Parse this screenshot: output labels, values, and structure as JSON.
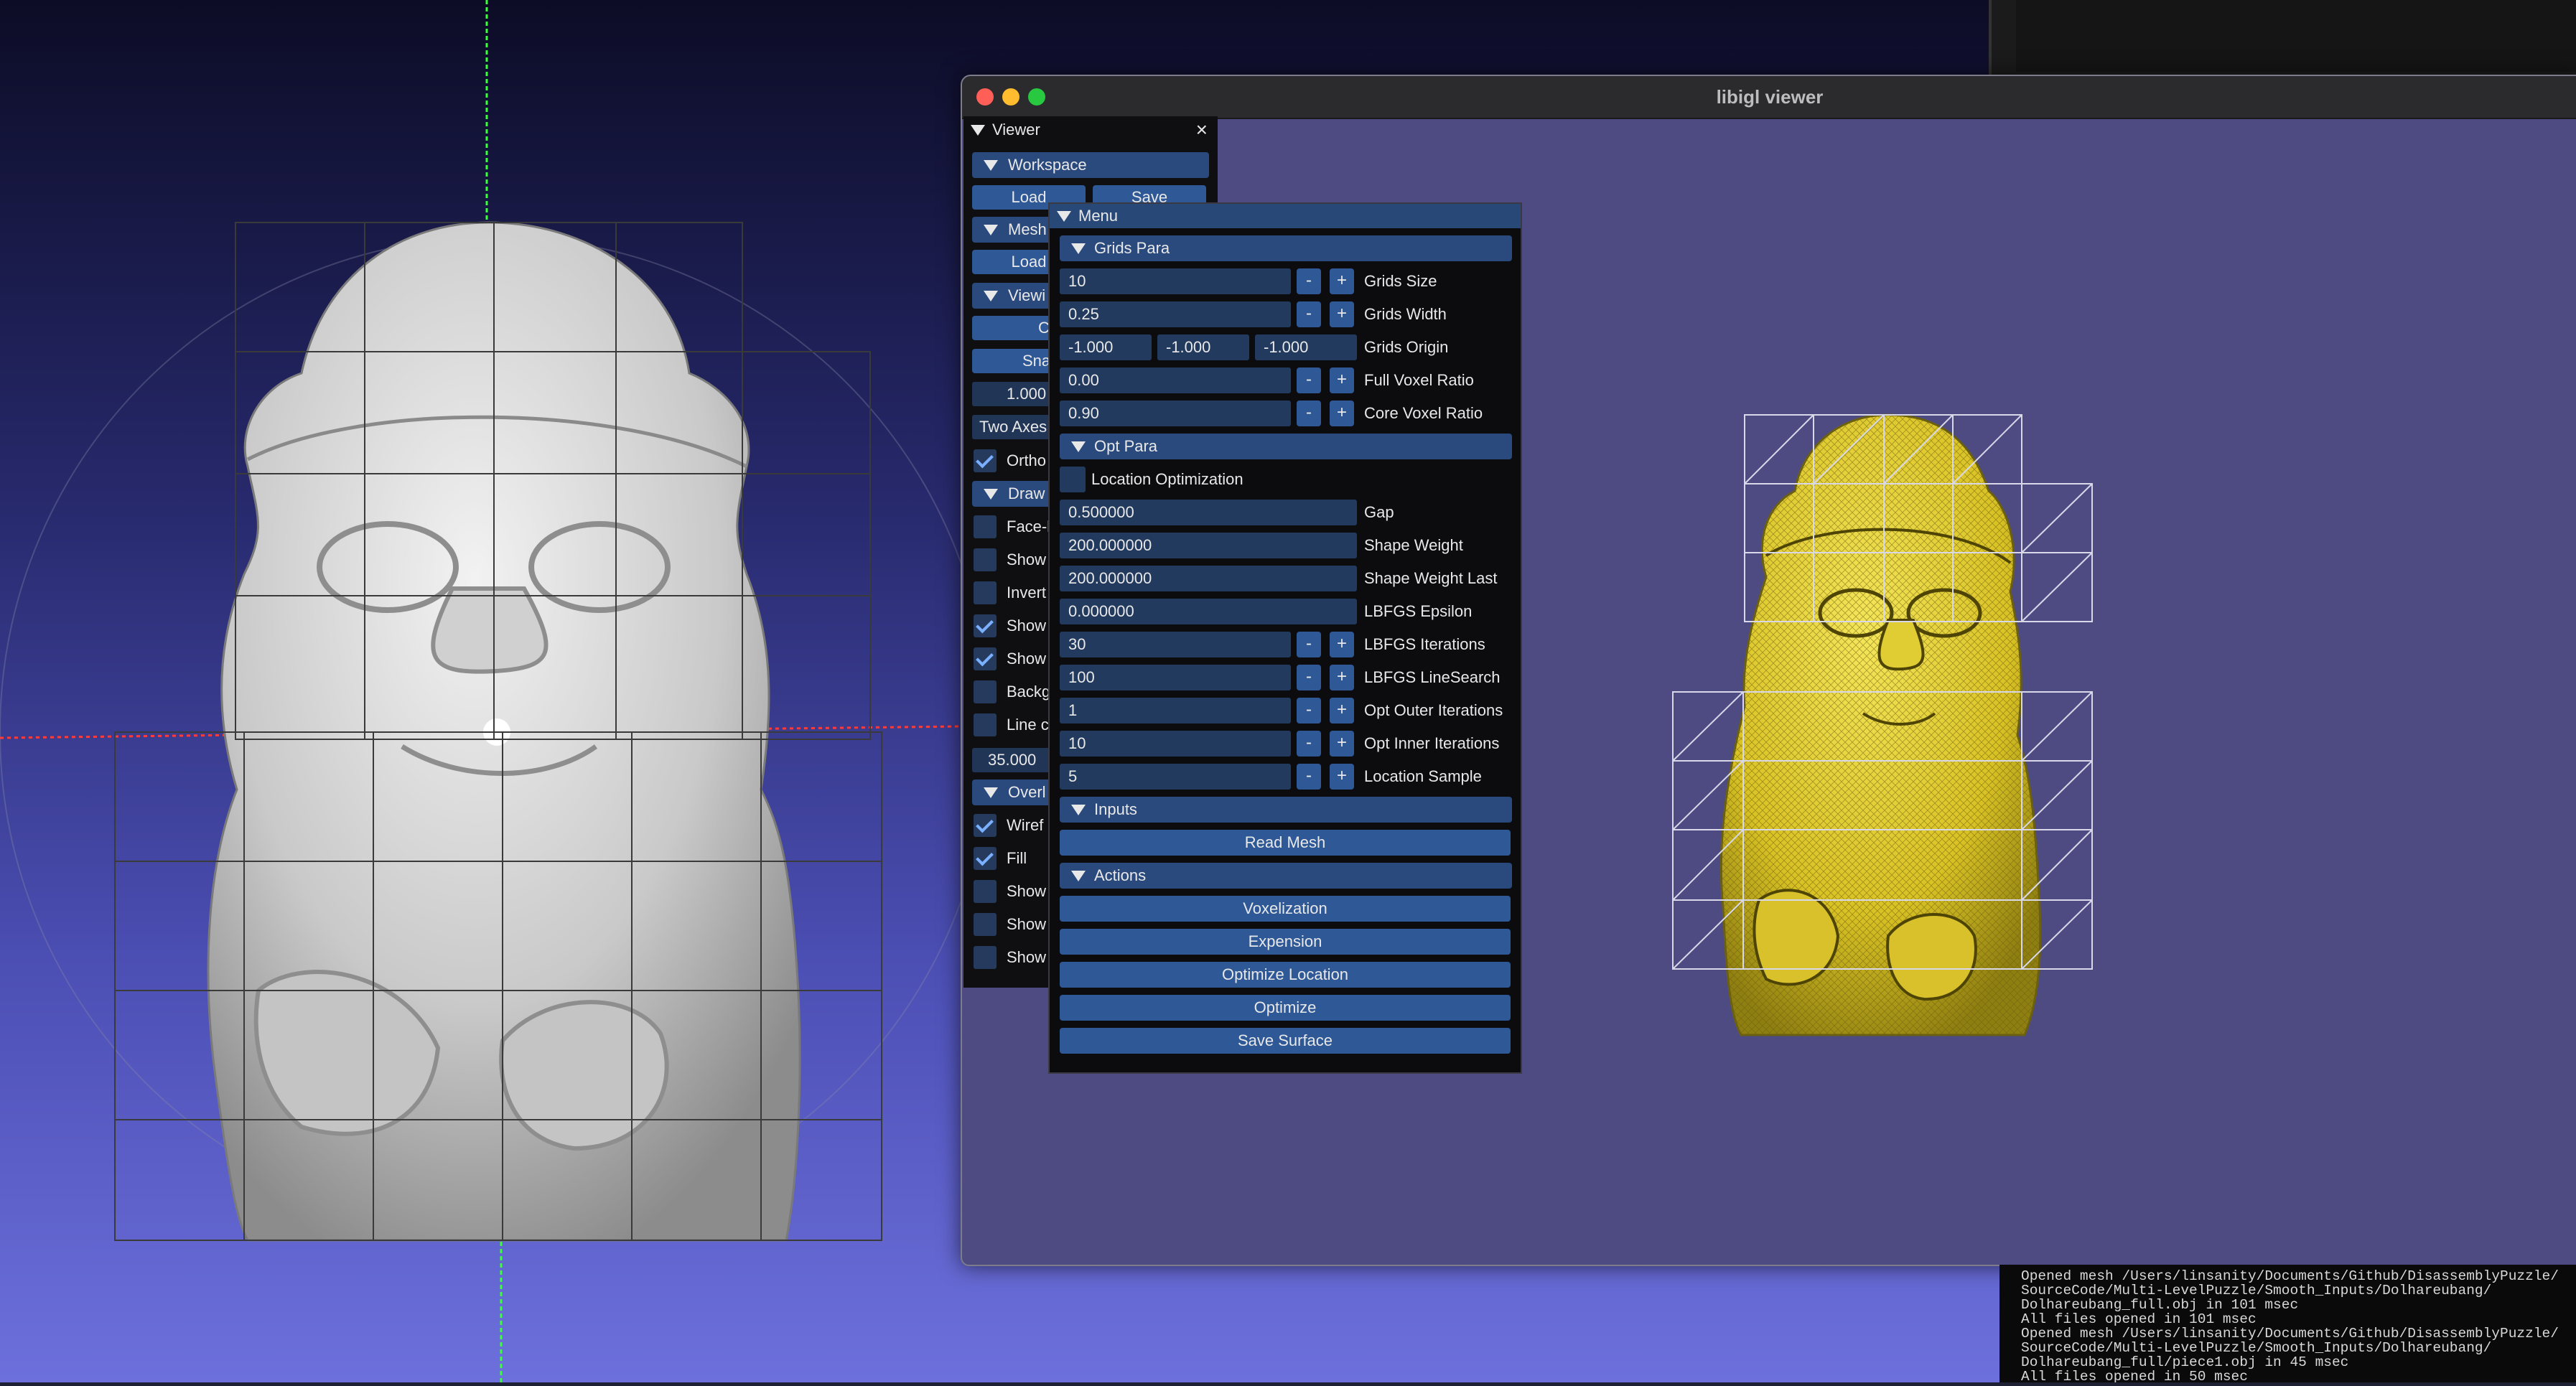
{
  "window": {
    "title": "libigl viewer",
    "traffic_colors": [
      "#ff5f57",
      "#febc2e",
      "#28c840"
    ]
  },
  "viewer_panel": {
    "title": "Viewer",
    "close_glyph": "×",
    "workspace": {
      "label": "Workspace",
      "load": "Load",
      "save": "Save"
    },
    "mesh": {
      "label": "Mesh",
      "load": "Load"
    },
    "viewing": {
      "label": "Viewi",
      "center_button": "C",
      "snap_button": "Snap",
      "zoom_value": "1.000",
      "rotation_mode": "Two Axes",
      "ortho_label": "Ortho"
    },
    "draw": {
      "label": "Draw",
      "items": [
        {
          "label": "Face-l",
          "checked": false
        },
        {
          "label": "Show",
          "checked": false
        },
        {
          "label": "Invert",
          "checked": false
        },
        {
          "label": "Show",
          "checked": true
        },
        {
          "label": "Show",
          "checked": true
        },
        {
          "label": "Backg",
          "checked": false
        },
        {
          "label": "Line c",
          "checked": false
        }
      ],
      "point_size": "35.000"
    },
    "overlays": {
      "label": "Overl",
      "items": [
        {
          "label": "Wiref",
          "checked": true
        },
        {
          "label": "Fill",
          "checked": true
        },
        {
          "label": "Show",
          "checked": false
        },
        {
          "label": "Show",
          "checked": false
        },
        {
          "label": "Show",
          "checked": false
        }
      ]
    }
  },
  "menu_panel": {
    "title": "Menu",
    "grids_para": {
      "label": "Grids Para",
      "grids_size": {
        "value": "10",
        "label": "Grids Size"
      },
      "grids_width": {
        "value": "0.25",
        "label": "Grids Width"
      },
      "grids_origin": {
        "x": "-1.000",
        "y": "-1.000",
        "z": "-1.000",
        "label": "Grids Origin"
      },
      "full_voxel_ratio": {
        "value": "0.00",
        "label": "Full Voxel Ratio"
      },
      "core_voxel_ratio": {
        "value": "0.90",
        "label": "Core Voxel Ratio"
      }
    },
    "opt_para": {
      "label": "Opt Para",
      "location_optimization": {
        "label": "Location Optimization",
        "checked": false
      },
      "gap": {
        "value": "0.500000",
        "label": "Gap"
      },
      "shape_weight": {
        "value": "200.000000",
        "label": "Shape Weight"
      },
      "shape_weight_last": {
        "value": "200.000000",
        "label": "Shape Weight Last"
      },
      "lbfgs_epsilon": {
        "value": "0.000000",
        "label": "LBFGS Epsilon"
      },
      "lbfgs_iterations": {
        "value": "30",
        "label": "LBFGS Iterations"
      },
      "lbfgs_linesearch": {
        "value": "100",
        "label": "LBFGS LineSearch"
      },
      "opt_outer_iterations": {
        "value": "1",
        "label": "Opt Outer Iterations"
      },
      "opt_inner_iterations": {
        "value": "10",
        "label": "Opt Inner Iterations"
      },
      "location_sample": {
        "value": "5",
        "label": "Location Sample"
      }
    },
    "inputs": {
      "label": "Inputs",
      "read_mesh": "Read Mesh"
    },
    "actions": {
      "label": "Actions",
      "voxelization": "Voxelization",
      "expension": "Expension",
      "optimize_location": "Optimize Location",
      "optimize": "Optimize",
      "save_surface": "Save Surface"
    },
    "minus": "-",
    "plus": "+"
  },
  "console": {
    "lines": [
      "Opened mesh /Users/linsanity/Documents/Github/DisassemblyPuzzle/",
      "SourceCode/Multi-LevelPuzzle/Smooth_Inputs/Dolhareubang/",
      "Dolhareubang_full.obj in 101 msec",
      "All files opened in 101 msec",
      "Opened mesh /Users/linsanity/Documents/Github/DisassemblyPuzzle/",
      "SourceCode/Multi-LevelPuzzle/Smooth_Inputs/Dolhareubang/",
      "Dolhareubang_full/piece1.obj in 45 msec",
      "All files opened in 50 msec"
    ]
  },
  "colors": {
    "statue_left": "#d4d4d4",
    "statue_right": "#e6d22c",
    "accent": "#2e5896"
  }
}
